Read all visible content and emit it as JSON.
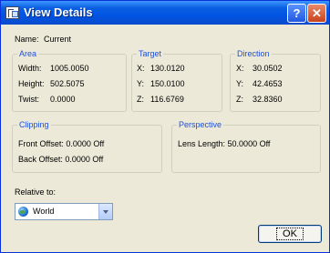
{
  "window": {
    "title": "View Details",
    "help_label": "?",
    "close_label": "✕",
    "icon": "view-details-icon"
  },
  "name": {
    "label": "Name:",
    "value": "Current"
  },
  "area": {
    "title": "Area",
    "width_label": "Width:",
    "width_value": "1005.0050",
    "height_label": "Height:",
    "height_value": "502.5075",
    "twist_label": "Twist:",
    "twist_value": "0.0000"
  },
  "target": {
    "title": "Target",
    "x_label": "X:",
    "x_value": "130.0120",
    "y_label": "Y:",
    "y_value": "150.0100",
    "z_label": "Z:",
    "z_value": "116.6769"
  },
  "direction": {
    "title": "Direction",
    "x_label": "X:",
    "x_value": "30.0502",
    "y_label": "Y:",
    "y_value": "42.4653",
    "z_label": "Z:",
    "z_value": "32.8360"
  },
  "clipping": {
    "title": "Clipping",
    "front": "Front Offset: 0.0000  Off",
    "back": "Back Offset: 0.0000  Off"
  },
  "perspective": {
    "title": "Perspective",
    "lens": "Lens Length: 50.0000  Off"
  },
  "relative": {
    "label": "Relative to:",
    "selected": "World",
    "icon": "globe-icon"
  },
  "buttons": {
    "ok": "OK"
  }
}
